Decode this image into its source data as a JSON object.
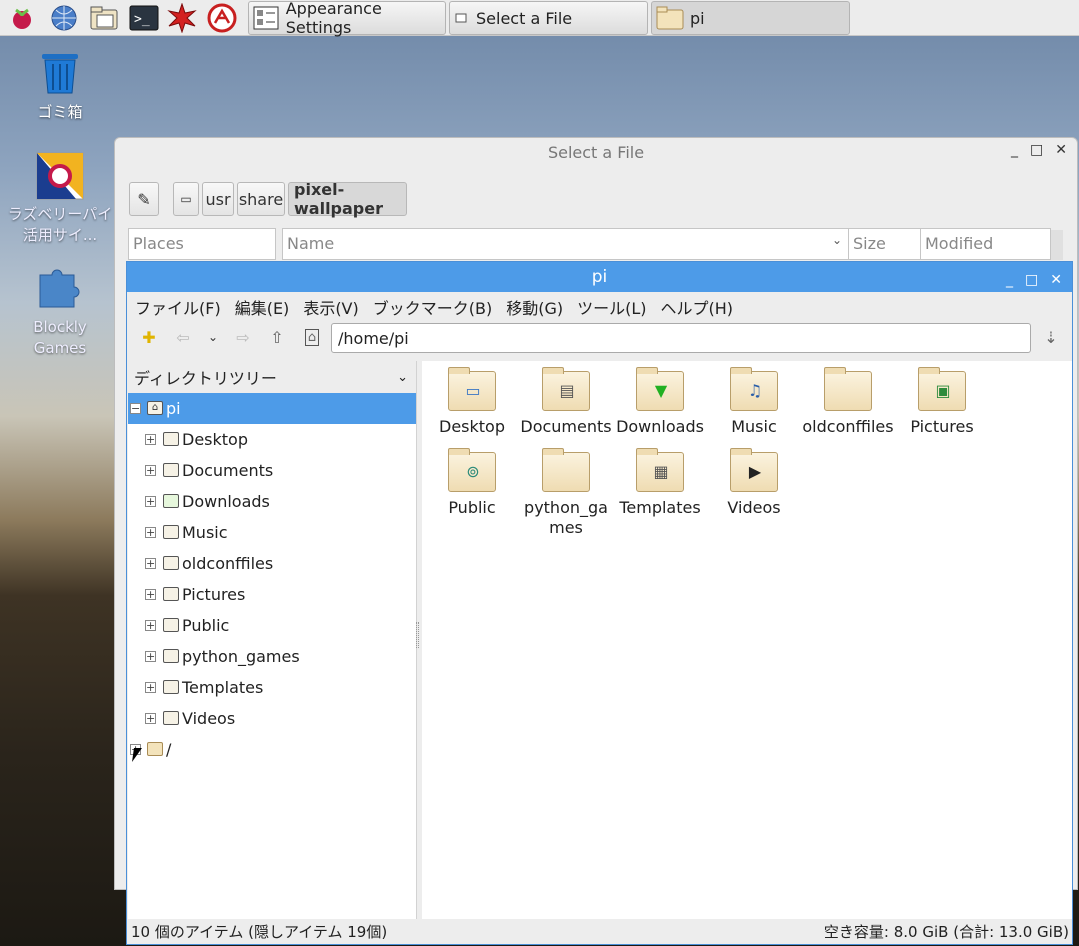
{
  "taskbar": {
    "launchers": [
      "raspberry-menu-icon",
      "web-browser-icon",
      "file-manager-icon",
      "terminal-icon",
      "math-icon",
      "wolfram-icon"
    ],
    "tasks": [
      {
        "label": "Appearance Settings",
        "icon": "settings-icon"
      },
      {
        "label": "Select a File",
        "icon": "window-icon"
      },
      {
        "label": "pi",
        "icon": "folder-icon"
      }
    ]
  },
  "desktop": {
    "trash": "ゴミ箱",
    "raspi_site": "ラズベリーパイ活用サイ...",
    "blockly": "Blockly Games"
  },
  "dialog": {
    "title": "Select a File",
    "path": [
      "usr",
      "share",
      "pixel-wallpaper"
    ],
    "places_header": "Places",
    "col_name": "Name",
    "col_size": "Size",
    "col_modified": "Modified"
  },
  "fm": {
    "title": "pi",
    "menu": [
      "ファイル(F)",
      "編集(E)",
      "表示(V)",
      "ブックマーク(B)",
      "移動(G)",
      "ツール(L)",
      "ヘルプ(H)"
    ],
    "location": "/home/pi",
    "sidepane_header": "ディレクトリツリー",
    "tree_root": "pi",
    "tree": [
      "Desktop",
      "Documents",
      "Downloads",
      "Music",
      "oldconffiles",
      "Pictures",
      "Public",
      "python_games",
      "Templates",
      "Videos"
    ],
    "tree_fs_root": "/",
    "items": [
      {
        "name": "Desktop",
        "icon": "desktop-folder-icon",
        "glyph": "▭"
      },
      {
        "name": "Documents",
        "icon": "documents-folder-icon",
        "glyph": "▤"
      },
      {
        "name": "Downloads",
        "icon": "downloads-folder-icon",
        "glyph": "▼"
      },
      {
        "name": "Music",
        "icon": "music-folder-icon",
        "glyph": "♫"
      },
      {
        "name": "oldconffiles",
        "icon": "folder-icon",
        "glyph": ""
      },
      {
        "name": "Pictures",
        "icon": "pictures-folder-icon",
        "glyph": "▣"
      },
      {
        "name": "Public",
        "icon": "public-folder-icon",
        "glyph": "⊚"
      },
      {
        "name": "python_games",
        "icon": "folder-icon",
        "glyph": ""
      },
      {
        "name": "Templates",
        "icon": "templates-folder-icon",
        "glyph": "▦"
      },
      {
        "name": "Videos",
        "icon": "videos-folder-icon",
        "glyph": "▶"
      }
    ],
    "status_left": "10 個のアイテム (隠しアイテム 19個)",
    "status_right": "空き容量: 8.0 GiB (合計: 13.0 GiB)"
  },
  "colors": {
    "accent": "#4d9be8",
    "folder": "#efdcb2"
  }
}
